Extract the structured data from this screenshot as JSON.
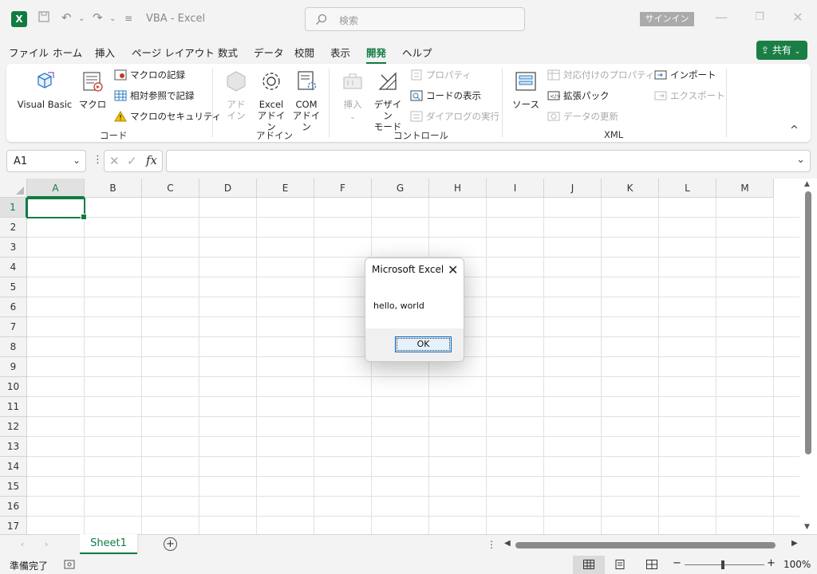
{
  "titlebar": {
    "app_letter": "X",
    "doc_title": "VBA - Excel",
    "search_placeholder": "検索",
    "signin_label": "サインイン"
  },
  "menu": {
    "tabs": [
      "ファイル",
      "ホーム",
      "挿入",
      "ページ レイアウト",
      "数式",
      "データ",
      "校閲",
      "表示",
      "開発",
      "ヘルプ"
    ],
    "active_tab": "開発",
    "share_label": "共有"
  },
  "ribbon": {
    "code": {
      "group_label": "コード",
      "visual_basic": "Visual Basic",
      "macro": "マクロ",
      "record_macro": "マクロの記録",
      "relative_ref": "相対参照で記録",
      "macro_security": "マクロのセキュリティ"
    },
    "addins": {
      "group_label": "アドイン",
      "addin_1": "アド",
      "addin_2": "イン",
      "excel_addin_1": "Excel",
      "excel_addin_2": "アドイン",
      "com_addin_1": "COM",
      "com_addin_2": "アドイン"
    },
    "controls": {
      "group_label": "コントロール",
      "insert": "挿入",
      "design_mode_1": "デザイン",
      "design_mode_2": "モード",
      "properties": "プロパティ",
      "view_code": "コードの表示",
      "run_dialog": "ダイアログの実行"
    },
    "xml": {
      "group_label": "XML",
      "source": "ソース",
      "map_properties": "対応付けのプロパティ",
      "expansion_packs": "拡張パック",
      "refresh_data": "データの更新",
      "import": "インポート",
      "export": "エクスポート"
    }
  },
  "formula_bar": {
    "name_box": "A1",
    "fx": "fx",
    "content": ""
  },
  "grid": {
    "columns": [
      "A",
      "B",
      "C",
      "D",
      "E",
      "F",
      "G",
      "H",
      "I",
      "J",
      "K",
      "L",
      "M"
    ],
    "rows": [
      "1",
      "2",
      "3",
      "4",
      "5",
      "6",
      "7",
      "8",
      "9",
      "10",
      "11",
      "12",
      "13",
      "14",
      "15",
      "16",
      "17"
    ],
    "selected_column": "A",
    "selected_row": "1"
  },
  "sheets": {
    "tabs": [
      "Sheet1"
    ],
    "active": "Sheet1"
  },
  "status": {
    "text": "準備完了",
    "zoom": "100%",
    "zoom_level_percent": 100
  },
  "dialog": {
    "title": "Microsoft Excel",
    "message": "hello, world",
    "ok_label": "OK"
  },
  "colors": {
    "accent": "#107c41",
    "share_button": "#1a7f45",
    "ok_border": "#0067c0"
  }
}
